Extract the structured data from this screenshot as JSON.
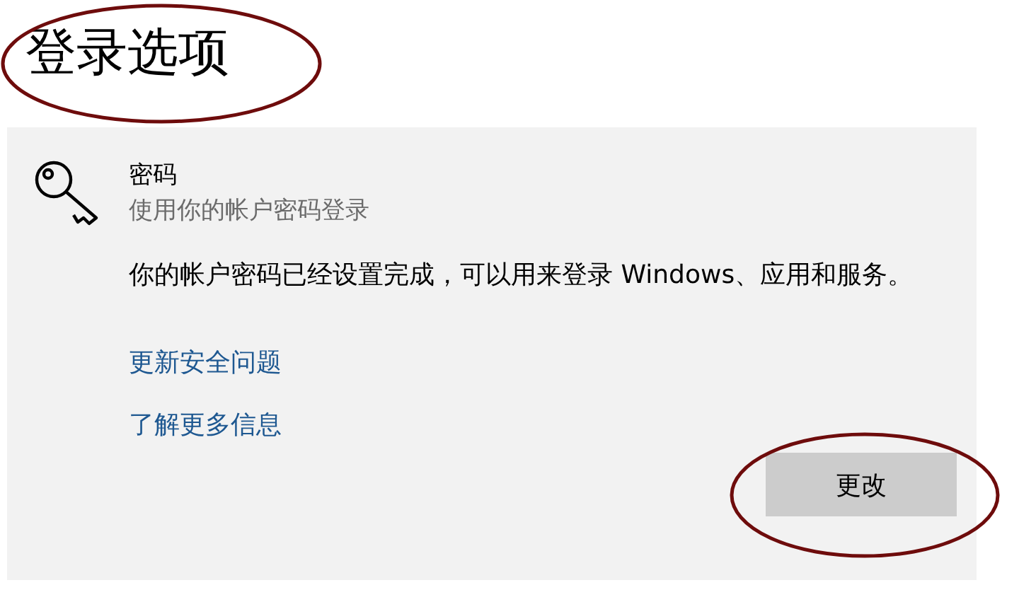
{
  "title": "登录选项",
  "section": {
    "heading": "密码",
    "subtitle": "使用你的帐户密码登录",
    "description": "你的帐户密码已经设置完成，可以用来登录 Windows、应用和服务。",
    "links": [
      "更新安全问题",
      "了解更多信息"
    ],
    "button": "更改"
  }
}
